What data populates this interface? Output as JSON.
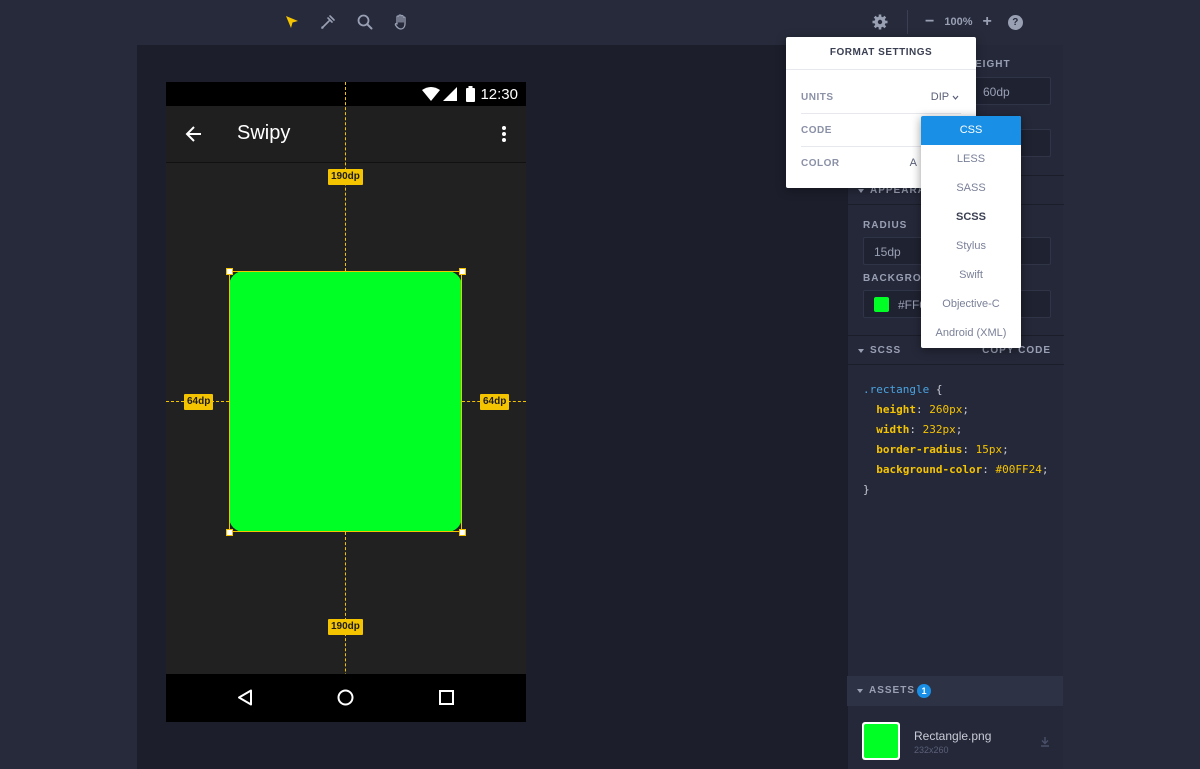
{
  "toolbar": {
    "tools": [
      "pointer-icon",
      "eyedropper-icon",
      "magnifier-icon",
      "hand-icon"
    ],
    "zoom_out": "−",
    "zoom_level": "100%",
    "zoom_in": "+",
    "help": "?"
  },
  "phone": {
    "status_time": "12:30",
    "app_title": "Swipy"
  },
  "measurements": {
    "top": "190dp",
    "bottom": "190dp",
    "left": "64dp",
    "right": "64dp"
  },
  "panel": {
    "height_label": "EIGHT",
    "height_value": "60dp",
    "appearance_label": "APPEARA",
    "radius_label": "RADIUS",
    "radius_value": "15dp",
    "background_label": "BACKGROU",
    "background_value": "#FF0",
    "code_section_label": "SCSS",
    "copy_code_label": "COPY CODE",
    "code": {
      "selector": ".rectangle",
      "open": " {",
      "lines": [
        {
          "prop": "height",
          "value": "260px"
        },
        {
          "prop": "width",
          "value": "232px"
        },
        {
          "prop": "border-radius",
          "value": "15px"
        },
        {
          "prop": "background-color",
          "value": "#00FF24"
        }
      ],
      "close": "}"
    },
    "assets_label": "ASSETS",
    "assets_count": "1",
    "asset_name": "Rectangle.png",
    "asset_size": "232x260"
  },
  "popover": {
    "title": "FORMAT SETTINGS",
    "rows": [
      {
        "key": "UNITS",
        "value": "DIP"
      },
      {
        "key": "CODE",
        "value": ""
      },
      {
        "key": "COLOR",
        "value": "A"
      }
    ]
  },
  "dropdown": {
    "options": [
      "CSS",
      "LESS",
      "SASS",
      "SCSS",
      "Stylus",
      "Swift",
      "Objective-C",
      "Android (XML)"
    ],
    "highlighted": "CSS",
    "current": "SCSS"
  },
  "colors": {
    "accent": "#f5c400",
    "shape": "#00ff24",
    "highlight": "#1a8fe6"
  }
}
